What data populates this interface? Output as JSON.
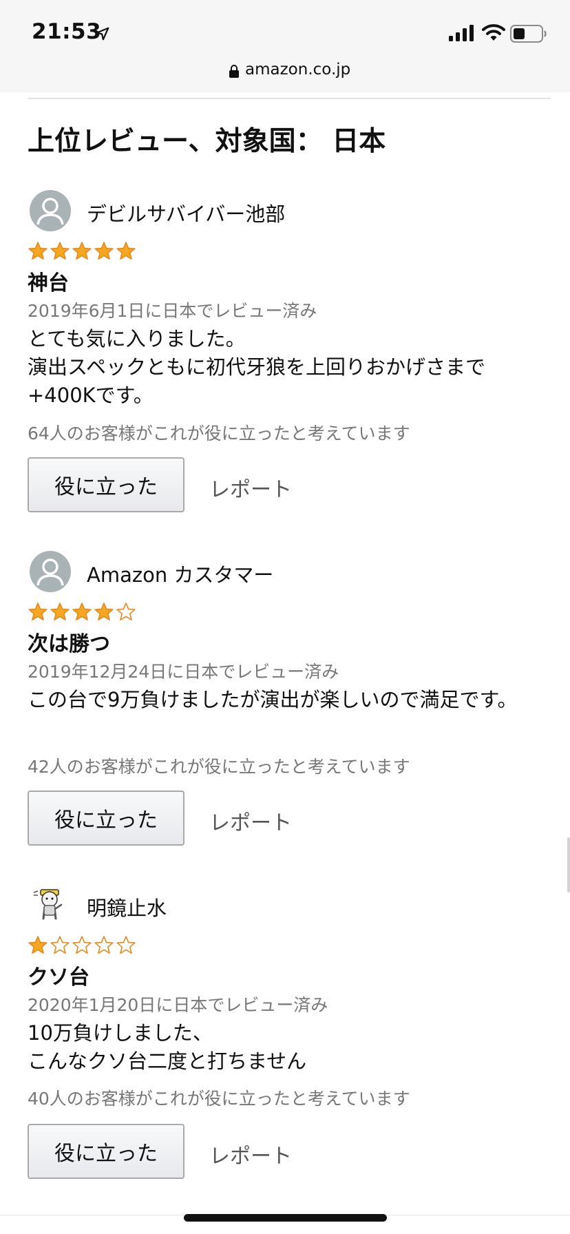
{
  "status_bar": {
    "time": "21:53"
  },
  "browser": {
    "url": "amazon.co.jp"
  },
  "section_title": "上位レビュー、対象国： 日本",
  "colors": {
    "star_fill": "#f5a623",
    "star_outline": "#e8891a",
    "secondary_text": "#777777"
  },
  "reviews": [
    {
      "reviewer": "デビルサバイバー池部",
      "avatar": "default-avatar-icon",
      "rating": 5,
      "title": "神台",
      "date": "2019年6月1日に日本でレビュー済み",
      "body_lines": [
        "とても気に入りました。",
        "演出スペックともに初代牙狼を上回りおかげさまで+400Kです。"
      ],
      "helpful_count": "64人のお客様がこれが役に立ったと考えています",
      "helpful_label": "役に立った",
      "report_label": "レポート"
    },
    {
      "reviewer": "Amazon カスタマー",
      "avatar": "default-avatar-icon",
      "rating": 4,
      "title": "次は勝つ",
      "date": "2019年12月24日に日本でレビュー済み",
      "body_lines": [
        "この台で9万負けましたが演出が楽しいので満足です。"
      ],
      "helpful_count": "42人のお客様がこれが役に立ったと考えています",
      "helpful_label": "役に立った",
      "report_label": "レポート"
    },
    {
      "reviewer": "明鏡止水",
      "avatar": "cat-character-avatar-icon",
      "rating": 1,
      "title": "クソ台",
      "date": "2020年1月20日に日本でレビュー済み",
      "body_lines": [
        "10万負けしました、",
        "こんなクソ台二度と打ちません"
      ],
      "helpful_count": "40人のお客様がこれが役に立ったと考えています",
      "helpful_label": "役に立った",
      "report_label": "レポート"
    }
  ]
}
